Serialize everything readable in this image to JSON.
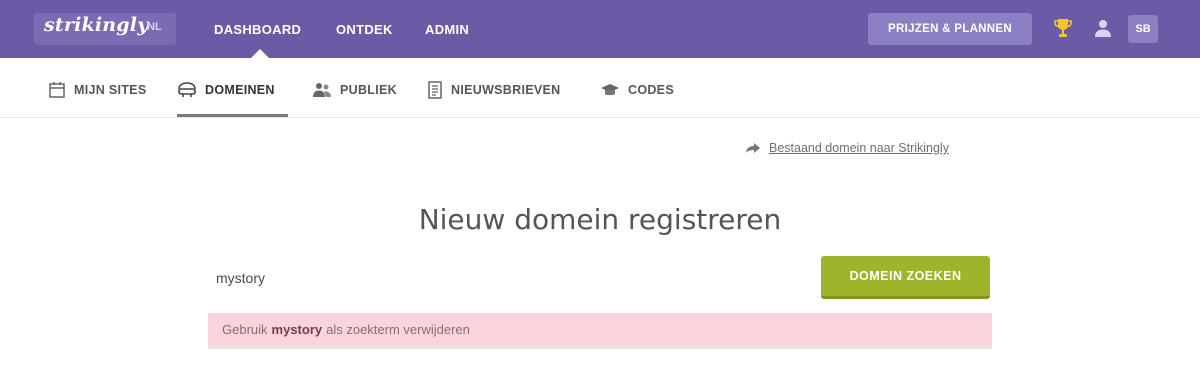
{
  "topbar": {
    "logo": "strikingly",
    "language": "NL",
    "nav": [
      {
        "label": "DASHBOARD"
      },
      {
        "label": "ONTDEK"
      },
      {
        "label": "ADMIN"
      }
    ],
    "plans_label": "PRIJZEN & PLANNEN",
    "avatar_initials": "SB",
    "accent_color": "#6b5aa6"
  },
  "subnav": {
    "items": [
      {
        "label": "MIJN SITES",
        "icon": "calendar-icon"
      },
      {
        "label": "DOMEINEN",
        "icon": "domain-icon"
      },
      {
        "label": "PUBLIEK",
        "icon": "people-icon"
      },
      {
        "label": "NIEUWSBRIEVEN",
        "icon": "newsletter-icon"
      },
      {
        "label": "CODES",
        "icon": "cap-icon"
      }
    ],
    "active": "DOMEINEN"
  },
  "main": {
    "transfer_link": "Bestaand domein naar Strikingly",
    "title": "Nieuw domein registreren",
    "search_value": "mystory",
    "search_button": "DOMEIN ZOEKEN",
    "button_color": "#9cb52b",
    "alert": {
      "prefix": "Gebruik",
      "keyword": "mystory",
      "suffix": "als zoekterm verwijderen",
      "background": "#f9d4dd"
    }
  }
}
